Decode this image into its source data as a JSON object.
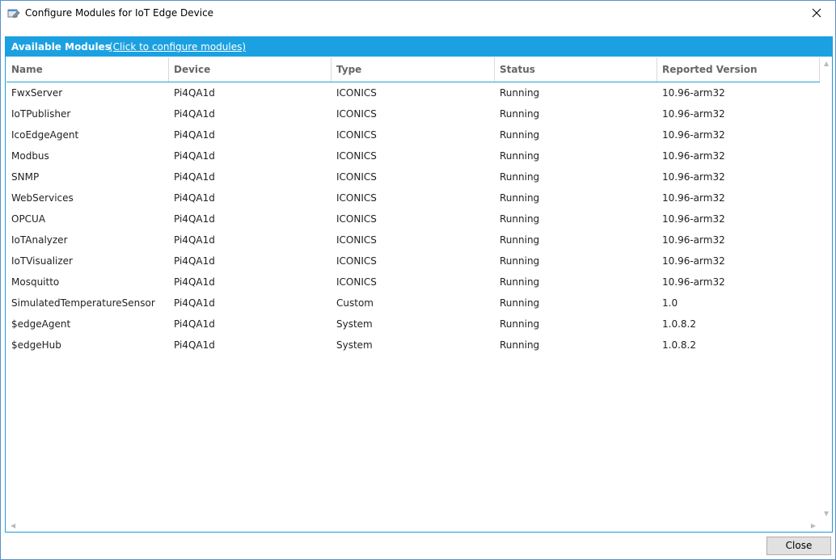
{
  "window": {
    "title": "Configure Modules for IoT Edge Device"
  },
  "panel": {
    "title": "Available Modules",
    "link": "(Click to configure modules)"
  },
  "table": {
    "columns": [
      "Name",
      "Device",
      "Type",
      "Status",
      "Reported Version"
    ],
    "rows": [
      [
        "FwxServer",
        "Pi4QA1d",
        "ICONICS",
        "Running",
        "10.96-arm32"
      ],
      [
        "IoTPublisher",
        "Pi4QA1d",
        "ICONICS",
        "Running",
        "10.96-arm32"
      ],
      [
        "IcoEdgeAgent",
        "Pi4QA1d",
        "ICONICS",
        "Running",
        "10.96-arm32"
      ],
      [
        "Modbus",
        "Pi4QA1d",
        "ICONICS",
        "Running",
        "10.96-arm32"
      ],
      [
        "SNMP",
        "Pi4QA1d",
        "ICONICS",
        "Running",
        "10.96-arm32"
      ],
      [
        "WebServices",
        "Pi4QA1d",
        "ICONICS",
        "Running",
        "10.96-arm32"
      ],
      [
        "OPCUA",
        "Pi4QA1d",
        "ICONICS",
        "Running",
        "10.96-arm32"
      ],
      [
        "IoTAnalyzer",
        "Pi4QA1d",
        "ICONICS",
        "Running",
        "10.96-arm32"
      ],
      [
        "IoTVisualizer",
        "Pi4QA1d",
        "ICONICS",
        "Running",
        "10.96-arm32"
      ],
      [
        "Mosquitto",
        "Pi4QA1d",
        "ICONICS",
        "Running",
        "10.96-arm32"
      ],
      [
        "SimulatedTemperatureSensor",
        "Pi4QA1d",
        "Custom",
        "Running",
        "1.0"
      ],
      [
        "$edgeAgent",
        "Pi4QA1d",
        "System",
        "Running",
        "1.0.8.2"
      ],
      [
        "$edgeHub",
        "Pi4QA1d",
        "System",
        "Running",
        "1.0.8.2"
      ]
    ]
  },
  "footer": {
    "close_label": "Close"
  },
  "icons": {
    "app": "configure-modules-icon",
    "close": "close-icon"
  },
  "colors": {
    "header_blue": "#1ba1e2",
    "border_blue": "#2a9fd6"
  }
}
